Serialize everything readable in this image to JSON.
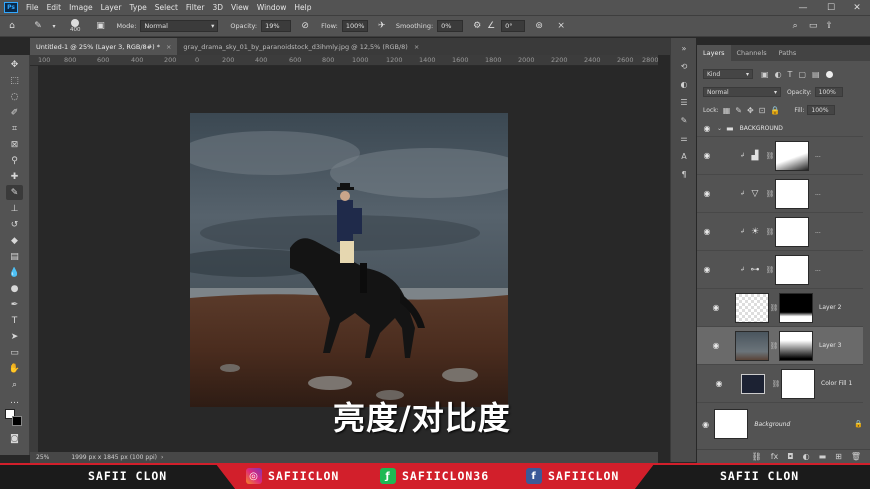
{
  "app": {
    "logo": "Ps"
  },
  "menu": [
    "File",
    "Edit",
    "Image",
    "Layer",
    "Type",
    "Select",
    "Filter",
    "3D",
    "View",
    "Window",
    "Help"
  ],
  "options": {
    "brush_size": "400",
    "mode_label": "Mode:",
    "mode_value": "Normal",
    "opacity_label": "Opacity:",
    "opacity_value": "19%",
    "flow_label": "Flow:",
    "flow_value": "100%",
    "smoothing_label": "Smoothing:",
    "smoothing_value": "0%",
    "angle_value": "0°"
  },
  "tabs": [
    {
      "label": "Untitled-1 @ 25% (Layer 3, RGB/8#) *"
    },
    {
      "label": "gray_drama_sky_01_by_paranoidstock_d3ihmly.jpg @ 12,5% (RGB/8)"
    }
  ],
  "ruler": [
    "100",
    "800",
    "600",
    "400",
    "200",
    "0",
    "200",
    "400",
    "600",
    "800",
    "1000",
    "1200",
    "1400",
    "1600",
    "1800",
    "2000",
    "2200",
    "2400",
    "2600",
    "2800"
  ],
  "status": {
    "zoom": "25%",
    "doc_size": "1999 px x 1845 px (100 ppi)"
  },
  "subtitle": "亮度/对比度",
  "panel": {
    "tabs": [
      "Layers",
      "Channels",
      "Paths"
    ],
    "filter_kind": "Kind",
    "blend_mode": "Normal",
    "opacity_label": "Opacity:",
    "opacity_value": "100%",
    "lock_label": "Lock:",
    "fill_label": "Fill:",
    "fill_value": "100%",
    "group_name": "BACKGROUND",
    "layers": [
      {
        "name": "..."
      },
      {
        "name": "..."
      },
      {
        "name": "..."
      },
      {
        "name": "..."
      },
      {
        "name": "Layer 2"
      },
      {
        "name": "Layer 3"
      },
      {
        "name": "Color Fill 1"
      },
      {
        "name": "Background"
      }
    ]
  },
  "social": {
    "left_name": "SAFII CLON",
    "instagram": "SAFIICLON",
    "other": "SAFIICLON36",
    "facebook": "SAFIICLON",
    "right_name": "SAFII CLON"
  },
  "colors": {
    "accent": "#31a8ff",
    "social_red": "#d21f2b",
    "panel_bg": "#535353",
    "canvas_bg": "#282828"
  }
}
